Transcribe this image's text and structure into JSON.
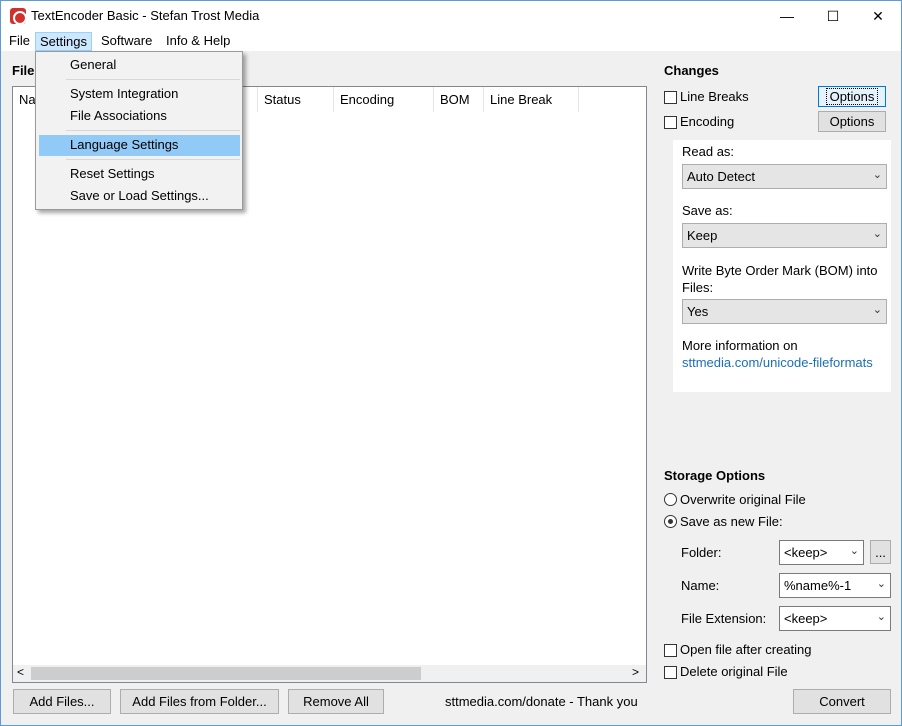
{
  "window": {
    "title": "TextEncoder Basic - Stefan Trost Media",
    "minimize": "—",
    "maximize": "☐",
    "close": "✕"
  },
  "menubar": {
    "items": [
      {
        "label": "File"
      },
      {
        "label": "Settings"
      },
      {
        "label": "Software"
      },
      {
        "label": "Info & Help"
      }
    ]
  },
  "settings_menu": {
    "items": [
      {
        "label": "General"
      },
      {
        "label": "System Integration"
      },
      {
        "label": "File Associations"
      },
      {
        "label": "Language Settings"
      },
      {
        "label": "Reset Settings"
      },
      {
        "label": "Save or Load Settings..."
      }
    ],
    "highlighted": "Language Settings"
  },
  "files": {
    "section_label": "File",
    "columns": [
      {
        "label": "Na"
      },
      {
        "label": "Status"
      },
      {
        "label": "Encoding"
      },
      {
        "label": "BOM"
      },
      {
        "label": "Line Break"
      }
    ],
    "scroll_left": "<",
    "scroll_right": ">"
  },
  "bottom": {
    "add_files": "Add Files...",
    "add_from_folder": "Add Files from Folder...",
    "remove_all": "Remove All",
    "donate": "sttmedia.com/donate - Thank you",
    "convert": "Convert"
  },
  "changes": {
    "title": "Changes",
    "line_breaks": "Line Breaks",
    "line_breaks_checked": false,
    "encoding": "Encoding",
    "encoding_checked": false,
    "options_label": "Options",
    "read_as_label": "Read as:",
    "read_as_value": "Auto Detect",
    "save_as_label": "Save as:",
    "save_as_value": "Keep",
    "bom_label": "Write Byte Order Mark (BOM) into Files:",
    "bom_value": "Yes",
    "more_info": "More information on",
    "more_info_link": "sttmedia.com/unicode-fileformats"
  },
  "storage": {
    "title": "Storage Options",
    "overwrite": "Overwrite original File",
    "save_new": "Save as new File:",
    "selected": "save_new",
    "folder_label": "Folder:",
    "folder_value": "<keep>",
    "browse": "...",
    "name_label": "Name:",
    "name_value": "%name%-1",
    "ext_label": "File Extension:",
    "ext_value": "<keep>",
    "open_after": "Open file after creating",
    "delete_original": "Delete original File"
  },
  "colors": {
    "highlight": "#91c9f7",
    "link": "#1a6fb5",
    "accent": "#0078d7"
  }
}
